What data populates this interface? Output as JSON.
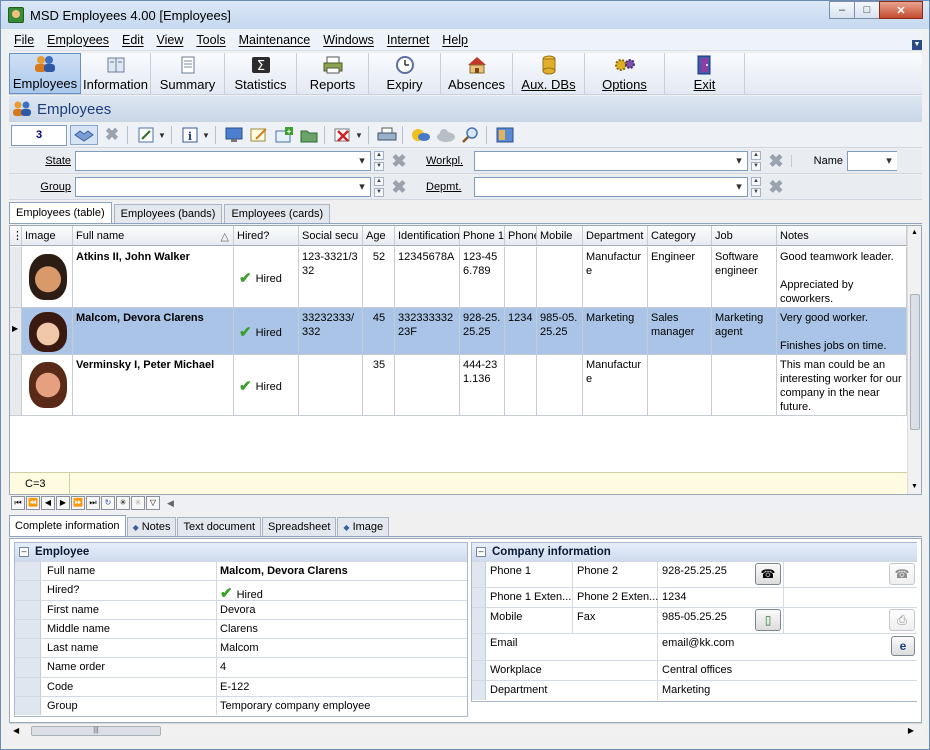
{
  "window": {
    "title": "MSD Employees 4.00 [Employees]",
    "min": "–",
    "max": "□",
    "close": "✕"
  },
  "menu": [
    "File",
    "Employees",
    "Edit",
    "View",
    "Tools",
    "Maintenance",
    "Windows",
    "Internet",
    "Help"
  ],
  "toolbar": [
    {
      "label": "Employees",
      "icon": "people-icon",
      "active": true
    },
    {
      "label": "Information",
      "icon": "book-icon"
    },
    {
      "label": "Summary",
      "icon": "document-icon"
    },
    {
      "label": "Statistics",
      "icon": "sigma-icon"
    },
    {
      "label": "Reports",
      "icon": "printer-icon"
    },
    {
      "label": "Expiry",
      "icon": "clock-icon"
    },
    {
      "label": "Absences",
      "icon": "house-icon"
    },
    {
      "label": "Aux. DBs",
      "icon": "database-icon"
    },
    {
      "label": "Options",
      "icon": "gears-icon"
    },
    {
      "label": "Exit",
      "icon": "exit-door-icon"
    }
  ],
  "section": {
    "title": "Employees"
  },
  "actionbar": {
    "counter": "3"
  },
  "filters": {
    "state_label": "State",
    "state_value": "",
    "group_label": "Group",
    "group_value": "",
    "workplace_label": "Workpl.",
    "workplace_value": "",
    "department_label": "Depmt.",
    "department_value": "",
    "name_label": "Name",
    "name_value": ""
  },
  "grid_tabs": [
    "Employees (table)",
    "Employees (bands)",
    "Employees (cards)"
  ],
  "grid": {
    "columns": [
      "Image",
      "Full name",
      "Hired?",
      "Social secu",
      "Age",
      "Identification",
      "Phone 1",
      "Phone",
      "Mobile",
      "Department",
      "Category",
      "Job",
      "Notes"
    ],
    "rows": [
      {
        "full_name": "Atkins II, John Walker",
        "hired": "Hired",
        "social": "123-3321/332",
        "age": "52",
        "id": "12345678A",
        "phone1": "123-456.789",
        "phone": "",
        "mobile": "",
        "department": "Manufacture",
        "category": "Engineer",
        "job": "Software engineer",
        "notes": "Good teamwork leader.\n\nAppreciated by coworkers."
      },
      {
        "full_name": "Malcom, Devora Clarens",
        "hired": "Hired",
        "social": "33232333/332",
        "age": "45",
        "id": "33233333223F",
        "phone1": "928-25.25.25",
        "phone": "1234",
        "mobile": "985-05.25.25",
        "department": "Marketing",
        "category": "Sales manager",
        "job": "Marketing agent",
        "notes": "Very good worker.\n\nFinishes jobs on time."
      },
      {
        "full_name": "Verminsky I, Peter Michael",
        "hired": "Hired",
        "social": "",
        "age": "35",
        "id": "",
        "phone1": "444-231.136",
        "phone": "",
        "mobile": "",
        "department": "Manufacture",
        "category": "",
        "job": "",
        "notes": "This man could be an interesting worker for our company in the near future."
      }
    ],
    "footer_count": "C=3"
  },
  "bottom_tabs": [
    "Complete information",
    "Notes",
    "Text document",
    "Spreadsheet",
    "Image"
  ],
  "employee_group": {
    "title": "Employee",
    "rows": [
      {
        "label": "Full name",
        "value": "Malcom, Devora Clarens"
      },
      {
        "label": "Hired?",
        "value": "Hired"
      },
      {
        "label": "First name",
        "value": "Devora"
      },
      {
        "label": "Middle name",
        "value": "Clarens"
      },
      {
        "label": "Last name",
        "value": "Malcom"
      },
      {
        "label": "Name order",
        "value": "4"
      },
      {
        "label": "Code",
        "value": "E-122"
      },
      {
        "label": "Group",
        "value": "Temporary company employee"
      }
    ]
  },
  "company_group": {
    "title": "Company information",
    "phone1_label": "Phone 1",
    "phone2_label": "Phone 2",
    "phone2_value": "928-25.25.25",
    "phone1ext_label": "Phone 1 Exten...",
    "phone2ext_label": "Phone 2 Exten...",
    "phone2ext_value": "1234",
    "mobile_label": "Mobile",
    "fax_label": "Fax",
    "fax_value": "985-05.25.25",
    "email_label": "Email",
    "email_value": "email@kk.com",
    "workplace_label": "Workplace",
    "workplace_value": "Central offices",
    "department_label": "Department",
    "department_value": "Marketing"
  },
  "colors": {
    "selected_row": "#a9c4e6",
    "title_text": "#1f3d7a",
    "hired_check": "#3aa02a"
  }
}
